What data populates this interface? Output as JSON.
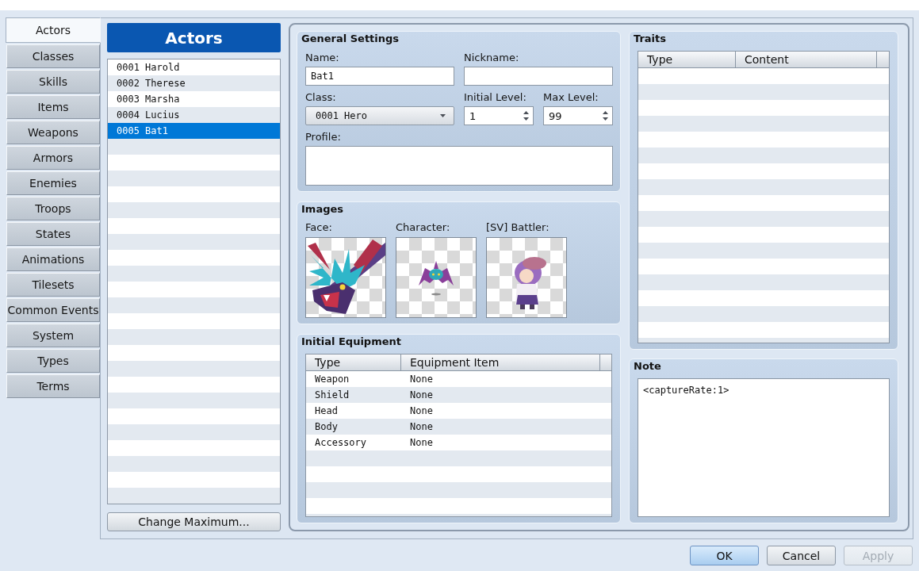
{
  "sidebar": {
    "tabs": [
      {
        "label": "Actors",
        "selected": true
      },
      {
        "label": "Classes",
        "selected": false
      },
      {
        "label": "Skills",
        "selected": false
      },
      {
        "label": "Items",
        "selected": false
      },
      {
        "label": "Weapons",
        "selected": false
      },
      {
        "label": "Armors",
        "selected": false
      },
      {
        "label": "Enemies",
        "selected": false
      },
      {
        "label": "Troops",
        "selected": false
      },
      {
        "label": "States",
        "selected": false
      },
      {
        "label": "Animations",
        "selected": false
      },
      {
        "label": "Tilesets",
        "selected": false
      },
      {
        "label": "Common Events",
        "selected": false
      },
      {
        "label": "System",
        "selected": false
      },
      {
        "label": "Types",
        "selected": false
      },
      {
        "label": "Terms",
        "selected": false
      }
    ]
  },
  "actor_list": {
    "title": "Actors",
    "items": [
      {
        "label": "0001 Harold",
        "selected": false
      },
      {
        "label": "0002 Therese",
        "selected": false
      },
      {
        "label": "0003 Marsha",
        "selected": false
      },
      {
        "label": "0004 Lucius",
        "selected": false
      },
      {
        "label": "0005 Bat1",
        "selected": true
      }
    ],
    "button": "Change Maximum..."
  },
  "general_settings": {
    "title": "General Settings",
    "fields": [
      {
        "kind": "text",
        "label": "Name:",
        "value": "Bat1"
      },
      {
        "kind": "text",
        "label": "Nickname:"
      },
      {
        "kind": "dropdown",
        "label": "Class:",
        "value": "0001 Hero"
      },
      {
        "kind": "spinner",
        "label": "Initial Level:",
        "value": "1"
      },
      {
        "kind": "spinner",
        "label": "Max Level:",
        "value": "99"
      },
      {
        "kind": "textarea",
        "label": "Profile:"
      }
    ]
  },
  "images": {
    "title": "Images",
    "slots": [
      {
        "kind": "face",
        "label": "Face:"
      },
      {
        "kind": "character",
        "label": "Character:"
      },
      {
        "kind": "battler",
        "label": "[SV] Battler:"
      }
    ]
  },
  "initial_equipment": {
    "title": "Initial Equipment",
    "columns": [
      "Type",
      "Equipment Item"
    ],
    "rows": [
      [
        "Weapon",
        "None"
      ],
      [
        "Shield",
        "None"
      ],
      [
        "Head",
        "None"
      ],
      [
        "Body",
        "None"
      ],
      [
        "Accessory",
        "None"
      ]
    ]
  },
  "traits": {
    "title": "Traits",
    "columns": [
      "Type",
      "Content"
    ]
  },
  "note": {
    "title": "Note",
    "value": "<captureRate:1>"
  },
  "buttons": [
    {
      "label": "OK",
      "default": true,
      "disabled": false
    },
    {
      "label": "Cancel",
      "default": false,
      "disabled": false
    },
    {
      "label": "Apply",
      "default": false,
      "disabled": true
    }
  ]
}
